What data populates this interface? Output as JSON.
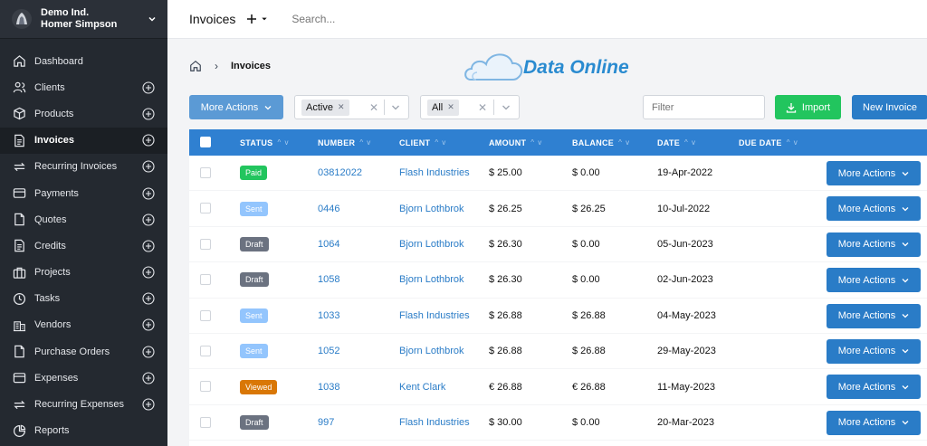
{
  "company": {
    "name": "Demo Ind.",
    "user": "Homer Simpson"
  },
  "sidebar": {
    "items": [
      {
        "label": "Dashboard",
        "icon": "home-icon",
        "plus": false,
        "active": false
      },
      {
        "label": "Clients",
        "icon": "users-icon",
        "plus": true,
        "active": false
      },
      {
        "label": "Products",
        "icon": "box-icon",
        "plus": true,
        "active": false
      },
      {
        "label": "Invoices",
        "icon": "file-text-icon",
        "plus": true,
        "active": true
      },
      {
        "label": "Recurring Invoices",
        "icon": "repeat-icon",
        "plus": true,
        "active": false
      },
      {
        "label": "Payments",
        "icon": "credit-card-icon",
        "plus": true,
        "active": false
      },
      {
        "label": "Quotes",
        "icon": "file-icon",
        "plus": true,
        "active": false
      },
      {
        "label": "Credits",
        "icon": "file-text-icon",
        "plus": true,
        "active": false
      },
      {
        "label": "Projects",
        "icon": "briefcase-icon",
        "plus": true,
        "active": false
      },
      {
        "label": "Tasks",
        "icon": "clock-icon",
        "plus": true,
        "active": false
      },
      {
        "label": "Vendors",
        "icon": "building-icon",
        "plus": true,
        "active": false
      },
      {
        "label": "Purchase Orders",
        "icon": "file-icon",
        "plus": true,
        "active": false
      },
      {
        "label": "Expenses",
        "icon": "wallet-icon",
        "plus": true,
        "active": false
      },
      {
        "label": "Recurring Expenses",
        "icon": "repeat-icon",
        "plus": true,
        "active": false
      },
      {
        "label": "Reports",
        "icon": "pie-chart-icon",
        "plus": false,
        "active": false
      }
    ]
  },
  "topbar": {
    "title": "Invoices",
    "search_placeholder": "Search..."
  },
  "breadcrumb": {
    "current": "Invoices"
  },
  "watermark": {
    "text": "Data Online"
  },
  "toolbar": {
    "more_actions": "More Actions",
    "status_chip": "Active",
    "client_chip": "All",
    "filter_placeholder": "Filter",
    "import_label": "Import",
    "new_invoice_label": "New Invoice"
  },
  "table": {
    "columns": [
      "STATUS",
      "NUMBER",
      "CLIENT",
      "AMOUNT",
      "BALANCE",
      "DATE",
      "DUE DATE"
    ],
    "row_action_label": "More Actions",
    "rows": [
      {
        "status": "Paid",
        "status_color": "#22c55e",
        "number": "03812022",
        "client": "Flash Industries",
        "amount": "$ 25.00",
        "balance": "$ 0.00",
        "date": "19-Apr-2022",
        "due_date": ""
      },
      {
        "status": "Sent",
        "status_color": "#93c5fd",
        "number": "0446",
        "client": "Bjorn Lothbrok",
        "amount": "$ 26.25",
        "balance": "$ 26.25",
        "date": "10-Jul-2022",
        "due_date": ""
      },
      {
        "status": "Draft",
        "status_color": "#6b7280",
        "number": "1064",
        "client": "Bjorn Lothbrok",
        "amount": "$ 26.30",
        "balance": "$ 0.00",
        "date": "05-Jun-2023",
        "due_date": ""
      },
      {
        "status": "Draft",
        "status_color": "#6b7280",
        "number": "1058",
        "client": "Bjorn Lothbrok",
        "amount": "$ 26.30",
        "balance": "$ 0.00",
        "date": "02-Jun-2023",
        "due_date": ""
      },
      {
        "status": "Sent",
        "status_color": "#93c5fd",
        "number": "1033",
        "client": "Flash Industries",
        "amount": "$ 26.88",
        "balance": "$ 26.88",
        "date": "04-May-2023",
        "due_date": ""
      },
      {
        "status": "Sent",
        "status_color": "#93c5fd",
        "number": "1052",
        "client": "Bjorn Lothbrok",
        "amount": "$ 26.88",
        "balance": "$ 26.88",
        "date": "29-May-2023",
        "due_date": ""
      },
      {
        "status": "Viewed",
        "status_color": "#d97706",
        "number": "1038",
        "client": "Kent Clark",
        "amount": "€ 26.88",
        "balance": "€ 26.88",
        "date": "11-May-2023",
        "due_date": ""
      },
      {
        "status": "Draft",
        "status_color": "#6b7280",
        "number": "997",
        "client": "Flash Industries",
        "amount": "$ 30.00",
        "balance": "$ 0.00",
        "date": "20-Mar-2023",
        "due_date": ""
      }
    ]
  }
}
